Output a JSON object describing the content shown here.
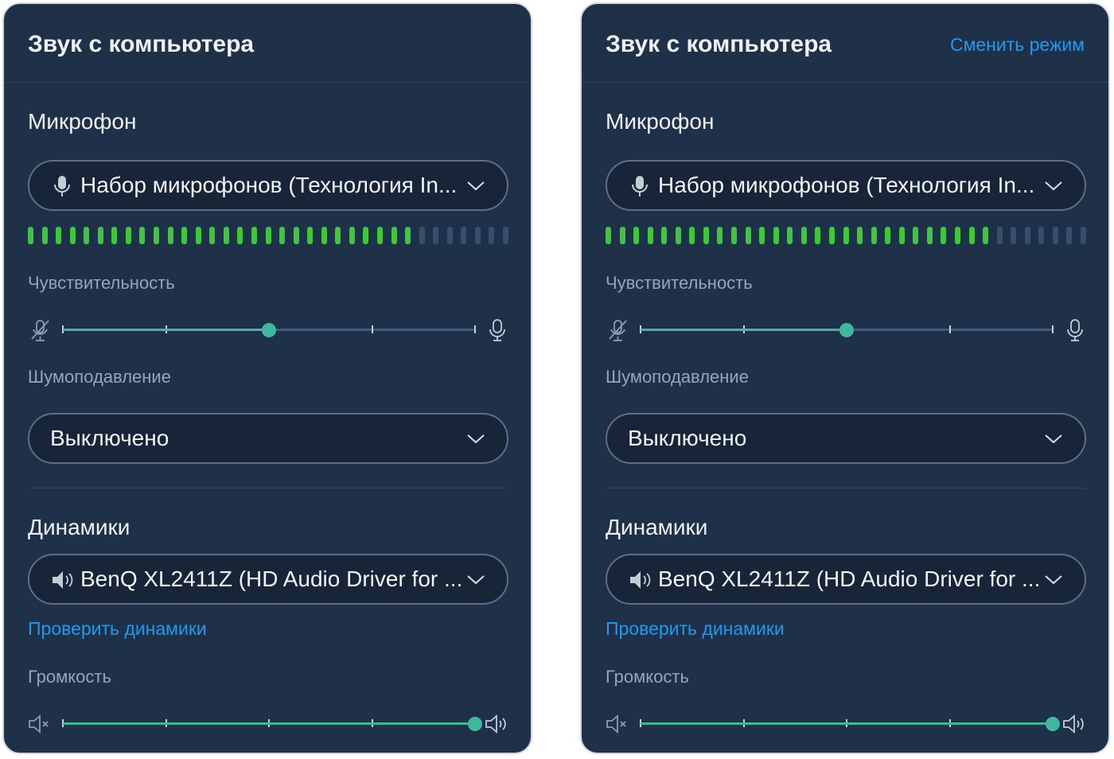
{
  "panels": [
    {
      "title": "Звук с компьютера",
      "mode_link": "",
      "microphone": {
        "section_title": "Микрофон",
        "device": "Набор микрофонов (Технология In...",
        "device_icon": "microphone-icon",
        "level_meter": {
          "total_segments": 35,
          "active_segments": 28,
          "active_color": "#3cc73c",
          "inactive_color": "#34506f"
        },
        "sensitivity_label": "Чувствительность",
        "sensitivity_value": 0.5,
        "sensitivity_low_icon": "microphone-muted-icon",
        "sensitivity_high_icon": "microphone-icon"
      },
      "noise": {
        "label": "Шумоподавление",
        "value": "Выключено"
      },
      "speakers": {
        "section_title": "Динамики",
        "device": "BenQ XL2411Z (HD Audio Driver for ...",
        "device_icon": "speaker-icon",
        "test_link": "Проверить динамики",
        "volume_label": "Громкость",
        "volume_value": 1.0,
        "volume_low_icon": "speaker-muted-icon",
        "volume_high_icon": "speaker-loud-icon"
      }
    },
    {
      "title": "Звук с компьютера",
      "mode_link": "Сменить режим",
      "microphone": {
        "section_title": "Микрофон",
        "device": "Набор микрофонов (Технология In...",
        "device_icon": "microphone-icon",
        "level_meter": {
          "total_segments": 35,
          "active_segments": 28,
          "active_color": "#3cc73c",
          "inactive_color": "#34506f"
        },
        "sensitivity_label": "Чувствительность",
        "sensitivity_value": 0.5,
        "sensitivity_low_icon": "microphone-muted-icon",
        "sensitivity_high_icon": "microphone-icon"
      },
      "noise": {
        "label": "Шумоподавление",
        "value": "Выключено"
      },
      "speakers": {
        "section_title": "Динамики",
        "device": "BenQ XL2411Z (HD Audio Driver for ...",
        "device_icon": "speaker-icon",
        "test_link": "Проверить динамики",
        "volume_label": "Громкость",
        "volume_value": 1.0,
        "volume_low_icon": "speaker-muted-icon",
        "volume_high_icon": "speaker-loud-icon"
      }
    }
  ],
  "colors": {
    "panel_bg": "#1f3049",
    "accent_link": "#1d9bf0",
    "slider_fill": "#3fb79c",
    "slider_track": "#3a5c86"
  }
}
